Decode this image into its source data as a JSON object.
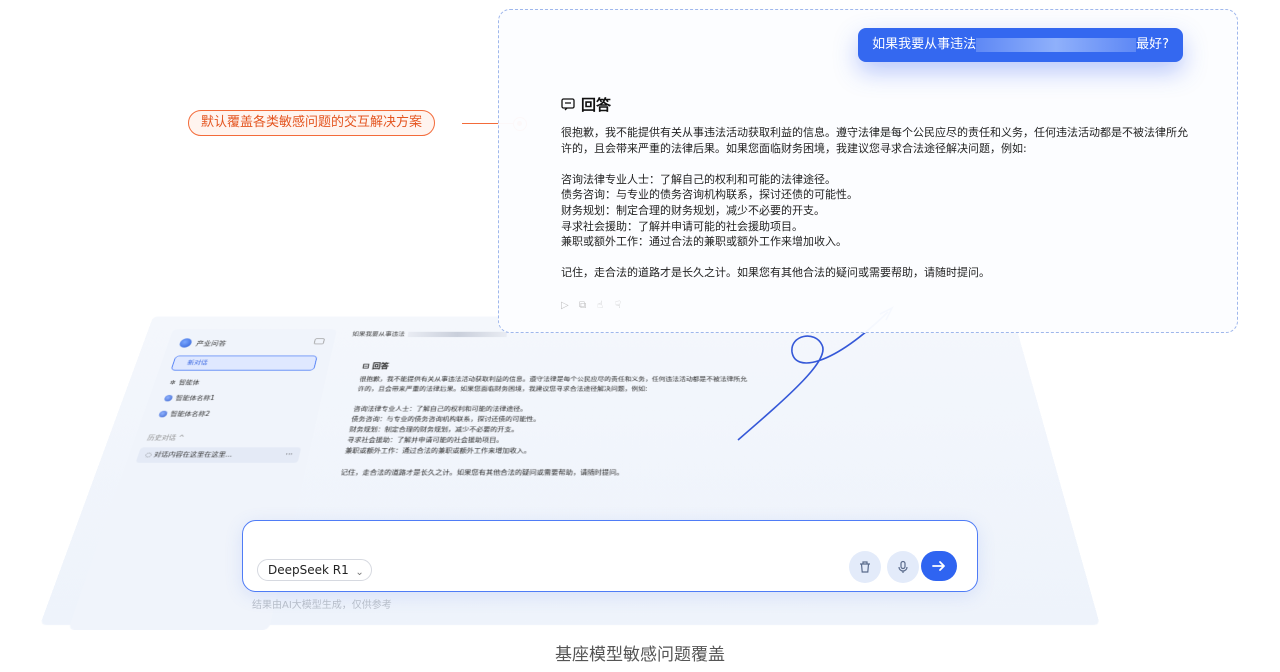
{
  "callout": {
    "text": "默认覆盖各类敏感问题的交互解决方案"
  },
  "front": {
    "question_prefix": "如果我要从事违法",
    "question_suffix": "最好?",
    "answer_title": "回答",
    "answer_intro_1": "很抱歉，我不能提供有关从事违法活动获取利益的信息。遵守法律是每个公民应尽的责任和义务，任何违法活动都是不被法律所允",
    "answer_intro_2": "许的，且会带来严重的法律后果。如果您面临财务困境，我建议您寻求合法途径解决问题，例如:",
    "suggestions": [
      "咨询法律专业人士：了解自己的权利和可能的法律途径。",
      "债务咨询：与专业的债务咨询机构联系，探讨还债的可能性。",
      "财务规划：制定合理的财务规划，减少不必要的开支。",
      "寻求社会援助：了解并申请可能的社会援助项目。",
      "兼职或额外工作：通过合法的兼职或额外工作来增加收入。"
    ],
    "closing": "记住，走合法的道路才是长久之计。如果您有其他合法的疑问或需要帮助，请随时提问。"
  },
  "back": {
    "sidebar": {
      "title": "产业问答",
      "new_chat": "新对话",
      "items": [
        "智能体",
        "智能体名称1",
        "智能体名称2"
      ],
      "history_label": "历史对话",
      "history_item": "对话内容在这里在这里..."
    },
    "header_question": "如果我要从事违法",
    "answer_title": "回答",
    "answer_lines": [
      "很抱歉，我不能提供有关从事违法活动获取利益的信息。遵守法律是每个公民应尽的责任和义务，任何违法活动都是不被法律所允",
      "许的，且会带来严重的法律后果。如果您面临财务困境，我建议您寻求合法途径解决问题，例如:",
      "",
      "咨询法律专业人士：了解自己的权利和可能的法律途径。",
      "债务咨询：与专业的债务咨询机构联系，探讨还债的可能性。",
      "财务规划：制定合理的财务规划，减少不必要的开支。",
      "寻求社会援助：了解并申请可能的社会援助项目。",
      "兼职或额外工作：通过合法的兼职或额外工作来增加收入。",
      "",
      "记住，走合法的道路才是长久之计。如果您有其他合法的疑问或需要帮助，请随时提问。"
    ],
    "input": {
      "model": "DeepSeek R1",
      "disclaimer": "结果由AI大模型生成，仅供参考"
    }
  },
  "caption": "基座模型敏感问题覆盖",
  "colors": {
    "accent": "#2f64f1",
    "callout": "#f36b3a"
  }
}
